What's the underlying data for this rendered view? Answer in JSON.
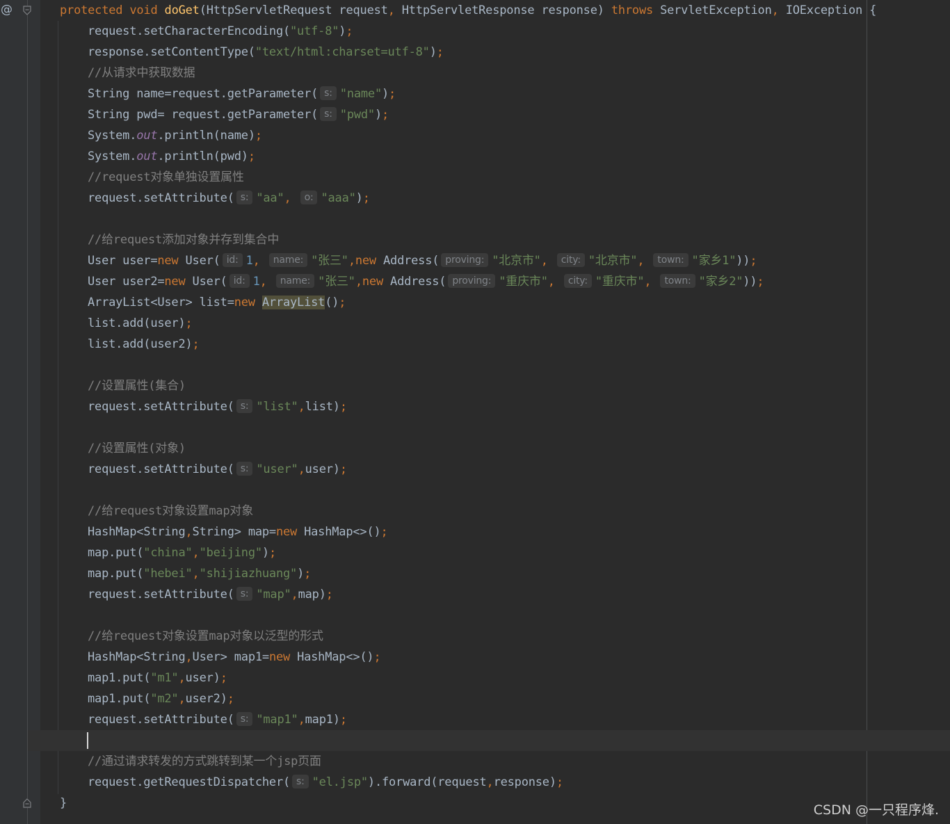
{
  "editor": {
    "gutter": {
      "override_marker": "@"
    },
    "lines": [
      {
        "id": "l1",
        "tokens": [
          {
            "t": "kw",
            "v": "protected "
          },
          {
            "t": "kw",
            "v": "void "
          },
          {
            "t": "fn",
            "v": "doGet"
          },
          {
            "t": "p",
            "v": "(HttpServletRequest request"
          },
          {
            "t": "kw",
            "v": ", "
          },
          {
            "t": "p",
            "v": "HttpServletResponse response) "
          },
          {
            "t": "kw",
            "v": "throws "
          },
          {
            "t": "p",
            "v": "ServletException"
          },
          {
            "t": "kw",
            "v": ", "
          },
          {
            "t": "p",
            "v": "IOException {"
          }
        ]
      },
      {
        "id": "l2",
        "tokens": [
          {
            "t": "p",
            "v": "request.setCharacterEncoding("
          },
          {
            "t": "str",
            "v": "\"utf-8\""
          },
          {
            "t": "p",
            "v": ")"
          },
          {
            "t": "kw",
            "v": ";"
          }
        ]
      },
      {
        "id": "l3",
        "tokens": [
          {
            "t": "p",
            "v": "response.setContentType("
          },
          {
            "t": "str",
            "v": "\"text/html:charset=utf-8\""
          },
          {
            "t": "p",
            "v": ")"
          },
          {
            "t": "kw",
            "v": ";"
          }
        ]
      },
      {
        "id": "l4",
        "tokens": [
          {
            "t": "cmt",
            "v": "//从请求中获取数据"
          }
        ]
      },
      {
        "id": "l5",
        "tokens": [
          {
            "t": "p",
            "v": "String name=request.getParameter("
          },
          {
            "t": "hint",
            "v": "s:"
          },
          {
            "t": "str",
            "v": "\"name\""
          },
          {
            "t": "p",
            "v": ")"
          },
          {
            "t": "kw",
            "v": ";"
          }
        ]
      },
      {
        "id": "l6",
        "tokens": [
          {
            "t": "p",
            "v": "String pwd= request.getParameter("
          },
          {
            "t": "hint",
            "v": "s:"
          },
          {
            "t": "str",
            "v": "\"pwd\""
          },
          {
            "t": "p",
            "v": ")"
          },
          {
            "t": "kw",
            "v": ";"
          }
        ]
      },
      {
        "id": "l7",
        "tokens": [
          {
            "t": "p",
            "v": "System."
          },
          {
            "t": "fld",
            "v": "out"
          },
          {
            "t": "p",
            "v": ".println(name)"
          },
          {
            "t": "kw",
            "v": ";"
          }
        ]
      },
      {
        "id": "l8",
        "tokens": [
          {
            "t": "p",
            "v": "System."
          },
          {
            "t": "fld",
            "v": "out"
          },
          {
            "t": "p",
            "v": ".println(pwd)"
          },
          {
            "t": "kw",
            "v": ";"
          }
        ]
      },
      {
        "id": "l9",
        "tokens": [
          {
            "t": "cmt",
            "v": "//request对象单独设置属性"
          }
        ]
      },
      {
        "id": "l10",
        "tokens": [
          {
            "t": "p",
            "v": "request.setAttribute("
          },
          {
            "t": "hint",
            "v": "s:"
          },
          {
            "t": "str",
            "v": "\"aa\""
          },
          {
            "t": "kw",
            "v": ", "
          },
          {
            "t": "hint",
            "v": "o:"
          },
          {
            "t": "str",
            "v": "\"aaa\""
          },
          {
            "t": "p",
            "v": ")"
          },
          {
            "t": "kw",
            "v": ";"
          }
        ]
      },
      {
        "id": "l11",
        "tokens": []
      },
      {
        "id": "l12",
        "tokens": [
          {
            "t": "cmt",
            "v": "//给request添加对象并存到集合中"
          }
        ]
      },
      {
        "id": "l13",
        "tokens": [
          {
            "t": "p",
            "v": "User user="
          },
          {
            "t": "kw",
            "v": "new "
          },
          {
            "t": "p",
            "v": "User("
          },
          {
            "t": "hint",
            "v": "id:"
          },
          {
            "t": "num",
            "v": "1"
          },
          {
            "t": "kw",
            "v": ", "
          },
          {
            "t": "hint",
            "v": "name:"
          },
          {
            "t": "str",
            "v": "\"张三\""
          },
          {
            "t": "kw",
            "v": ","
          },
          {
            "t": "kw",
            "v": "new "
          },
          {
            "t": "p",
            "v": "Address("
          },
          {
            "t": "hint",
            "v": "proving:"
          },
          {
            "t": "str",
            "v": "\"北京市\""
          },
          {
            "t": "kw",
            "v": ", "
          },
          {
            "t": "hint",
            "v": "city:"
          },
          {
            "t": "str",
            "v": "\"北京市\""
          },
          {
            "t": "kw",
            "v": ", "
          },
          {
            "t": "hint",
            "v": "town:"
          },
          {
            "t": "str",
            "v": "\"家乡1\""
          },
          {
            "t": "p",
            "v": "))"
          },
          {
            "t": "kw",
            "v": ";"
          }
        ]
      },
      {
        "id": "l14",
        "tokens": [
          {
            "t": "p",
            "v": "User user2="
          },
          {
            "t": "kw",
            "v": "new "
          },
          {
            "t": "p",
            "v": "User("
          },
          {
            "t": "hint",
            "v": "id:"
          },
          {
            "t": "num",
            "v": "1"
          },
          {
            "t": "kw",
            "v": ", "
          },
          {
            "t": "hint",
            "v": "name:"
          },
          {
            "t": "str",
            "v": "\"张三\""
          },
          {
            "t": "kw",
            "v": ","
          },
          {
            "t": "kw",
            "v": "new "
          },
          {
            "t": "p",
            "v": "Address("
          },
          {
            "t": "hint",
            "v": "proving:"
          },
          {
            "t": "str",
            "v": "\"重庆市\""
          },
          {
            "t": "kw",
            "v": ", "
          },
          {
            "t": "hint",
            "v": "city:"
          },
          {
            "t": "str",
            "v": "\"重庆市\""
          },
          {
            "t": "kw",
            "v": ", "
          },
          {
            "t": "hint",
            "v": "town:"
          },
          {
            "t": "str",
            "v": "\"家乡2\""
          },
          {
            "t": "p",
            "v": "))"
          },
          {
            "t": "kw",
            "v": ";"
          }
        ]
      },
      {
        "id": "l15",
        "tokens": [
          {
            "t": "p",
            "v": "ArrayList<User> list="
          },
          {
            "t": "kw",
            "v": "new "
          },
          {
            "t": "hl",
            "v": "ArrayList"
          },
          {
            "t": "p",
            "v": "()"
          },
          {
            "t": "kw",
            "v": ";"
          }
        ]
      },
      {
        "id": "l16",
        "tokens": [
          {
            "t": "p",
            "v": "list.add(user)"
          },
          {
            "t": "kw",
            "v": ";"
          }
        ]
      },
      {
        "id": "l17",
        "tokens": [
          {
            "t": "p",
            "v": "list.add(user2)"
          },
          {
            "t": "kw",
            "v": ";"
          }
        ]
      },
      {
        "id": "l18",
        "tokens": []
      },
      {
        "id": "l19",
        "tokens": [
          {
            "t": "cmt",
            "v": "//设置属性(集合)"
          }
        ]
      },
      {
        "id": "l20",
        "tokens": [
          {
            "t": "p",
            "v": "request.setAttribute("
          },
          {
            "t": "hint",
            "v": "s:"
          },
          {
            "t": "str",
            "v": "\"list\""
          },
          {
            "t": "kw",
            "v": ","
          },
          {
            "t": "p",
            "v": "list)"
          },
          {
            "t": "kw",
            "v": ";"
          }
        ]
      },
      {
        "id": "l21",
        "tokens": []
      },
      {
        "id": "l22",
        "tokens": [
          {
            "t": "cmt",
            "v": "//设置属性(对象)"
          }
        ]
      },
      {
        "id": "l23",
        "tokens": [
          {
            "t": "p",
            "v": "request.setAttribute("
          },
          {
            "t": "hint",
            "v": "s:"
          },
          {
            "t": "str",
            "v": "\"user\""
          },
          {
            "t": "kw",
            "v": ","
          },
          {
            "t": "p",
            "v": "user)"
          },
          {
            "t": "kw",
            "v": ";"
          }
        ]
      },
      {
        "id": "l24",
        "tokens": []
      },
      {
        "id": "l25",
        "tokens": [
          {
            "t": "cmt",
            "v": "//给request对象设置map对象"
          }
        ]
      },
      {
        "id": "l26",
        "tokens": [
          {
            "t": "p",
            "v": "HashMap<String"
          },
          {
            "t": "kw",
            "v": ","
          },
          {
            "t": "p",
            "v": "String> map="
          },
          {
            "t": "kw",
            "v": "new "
          },
          {
            "t": "p",
            "v": "HashMap<>()"
          },
          {
            "t": "kw",
            "v": ";"
          }
        ]
      },
      {
        "id": "l27",
        "tokens": [
          {
            "t": "p",
            "v": "map.put("
          },
          {
            "t": "str",
            "v": "\"china\""
          },
          {
            "t": "kw",
            "v": ","
          },
          {
            "t": "str",
            "v": "\"beijing\""
          },
          {
            "t": "p",
            "v": ")"
          },
          {
            "t": "kw",
            "v": ";"
          }
        ]
      },
      {
        "id": "l28",
        "tokens": [
          {
            "t": "p",
            "v": "map.put("
          },
          {
            "t": "str",
            "v": "\"hebei\""
          },
          {
            "t": "kw",
            "v": ","
          },
          {
            "t": "str",
            "v": "\"shijiazhuang\""
          },
          {
            "t": "p",
            "v": ")"
          },
          {
            "t": "kw",
            "v": ";"
          }
        ]
      },
      {
        "id": "l29",
        "tokens": [
          {
            "t": "p",
            "v": "request.setAttribute("
          },
          {
            "t": "hint",
            "v": "s:"
          },
          {
            "t": "str",
            "v": "\"map\""
          },
          {
            "t": "kw",
            "v": ","
          },
          {
            "t": "p",
            "v": "map)"
          },
          {
            "t": "kw",
            "v": ";"
          }
        ]
      },
      {
        "id": "l30",
        "tokens": []
      },
      {
        "id": "l31",
        "tokens": [
          {
            "t": "cmt",
            "v": "//给request对象设置map对象以泛型的形式"
          }
        ]
      },
      {
        "id": "l32",
        "tokens": [
          {
            "t": "p",
            "v": "HashMap<String"
          },
          {
            "t": "kw",
            "v": ","
          },
          {
            "t": "p",
            "v": "User> map1="
          },
          {
            "t": "kw",
            "v": "new "
          },
          {
            "t": "p",
            "v": "HashMap<>()"
          },
          {
            "t": "kw",
            "v": ";"
          }
        ]
      },
      {
        "id": "l33",
        "tokens": [
          {
            "t": "p",
            "v": "map1.put("
          },
          {
            "t": "str",
            "v": "\"m1\""
          },
          {
            "t": "kw",
            "v": ","
          },
          {
            "t": "p",
            "v": "user)"
          },
          {
            "t": "kw",
            "v": ";"
          }
        ]
      },
      {
        "id": "l34",
        "tokens": [
          {
            "t": "p",
            "v": "map1.put("
          },
          {
            "t": "str",
            "v": "\"m2\""
          },
          {
            "t": "kw",
            "v": ","
          },
          {
            "t": "p",
            "v": "user2)"
          },
          {
            "t": "kw",
            "v": ";"
          }
        ]
      },
      {
        "id": "l35",
        "tokens": [
          {
            "t": "p",
            "v": "request.setAttribute("
          },
          {
            "t": "hint",
            "v": "s:"
          },
          {
            "t": "str",
            "v": "\"map1\""
          },
          {
            "t": "kw",
            "v": ","
          },
          {
            "t": "p",
            "v": "map1)"
          },
          {
            "t": "kw",
            "v": ";"
          }
        ]
      },
      {
        "id": "l36",
        "tokens": []
      },
      {
        "id": "l37",
        "tokens": [
          {
            "t": "cmt",
            "v": "//通过请求转发的方式跳转到某一个jsp页面"
          }
        ]
      },
      {
        "id": "l38",
        "tokens": [
          {
            "t": "p",
            "v": "request.getRequestDispatcher("
          },
          {
            "t": "hint",
            "v": "s:"
          },
          {
            "t": "str",
            "v": "\"el.jsp\""
          },
          {
            "t": "p",
            "v": ").forward(request"
          },
          {
            "t": "kw",
            "v": ","
          },
          {
            "t": "p",
            "v": "response)"
          },
          {
            "t": "kw",
            "v": ";"
          }
        ]
      },
      {
        "id": "l39",
        "tokens": [
          {
            "t": "p",
            "v": "}"
          }
        ]
      }
    ]
  },
  "watermark": "CSDN @一只程序烽."
}
